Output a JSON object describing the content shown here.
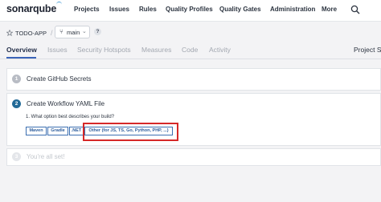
{
  "topnav": {
    "logo": "sonarqube",
    "items": [
      "Projects",
      "Issues",
      "Rules",
      "Quality Profiles",
      "Quality Gates",
      "Administration",
      "More"
    ]
  },
  "project": {
    "name": "TODO-APP",
    "branch": "main",
    "help": "?"
  },
  "tabs": [
    "Overview",
    "Issues",
    "Security Hotspots",
    "Measures",
    "Code",
    "Activity",
    "Project S"
  ],
  "steps": [
    {
      "number": "1",
      "title": "Create GitHub Secrets"
    },
    {
      "number": "2",
      "title": "Create Workflow YAML File"
    },
    {
      "number": "3",
      "title": "You're all set!"
    }
  ],
  "question": "1. What option best describes your build?",
  "build_options": [
    "Maven",
    "Gradle",
    ".NET",
    "Other (for JS, TS, Go, Python, PHP, ...)"
  ],
  "colors": {
    "accent": "#3a63b8",
    "highlight": "#d62828",
    "step_done": "#b8bcc4",
    "step_active": "#236a97"
  }
}
